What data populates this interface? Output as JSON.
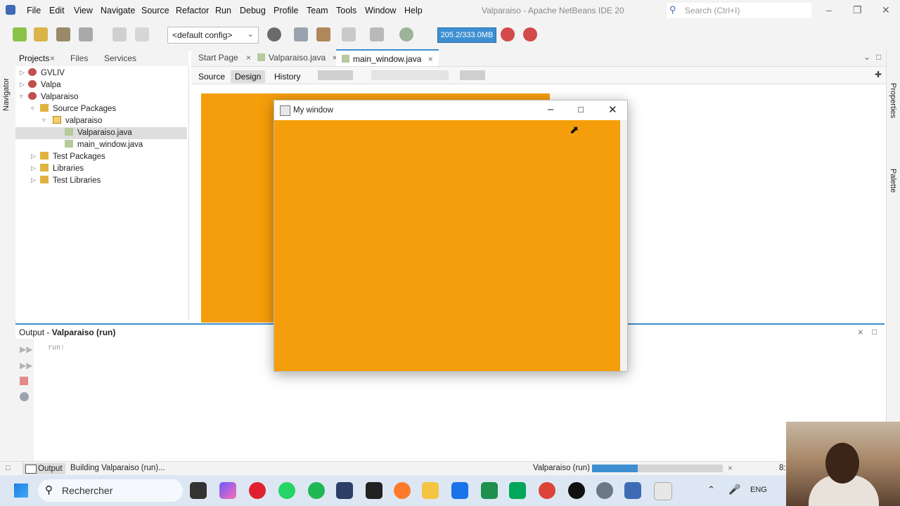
{
  "menubar": {
    "items": [
      "File",
      "Edit",
      "View",
      "Navigate",
      "Source",
      "Refactor",
      "Run",
      "Debug",
      "Profile",
      "Team",
      "Tools",
      "Window",
      "Help"
    ],
    "app_title": "Valparaiso - Apache NetBeans IDE 20",
    "search_placeholder": "Search (Ctrl+I)"
  },
  "toolbar": {
    "config_value": "<default config>",
    "memory": "205.2/333.0MB"
  },
  "left_panel": {
    "navigator_label": "Navigator",
    "tabs": [
      "Projects",
      "Files",
      "Services"
    ],
    "tree": [
      {
        "label": "GVLIV"
      },
      {
        "label": "Valpa"
      },
      {
        "label": "Valparaiso"
      },
      {
        "label": "Source Packages"
      },
      {
        "label": "valparaiso"
      },
      {
        "label": "Valparaiso.java"
      },
      {
        "label": "main_window.java"
      },
      {
        "label": "Test Packages"
      },
      {
        "label": "Libraries"
      },
      {
        "label": "Test Libraries"
      }
    ]
  },
  "editor": {
    "tabs": [
      "Start Page",
      "Valparaiso.java",
      "main_window.java"
    ],
    "views": [
      "Source",
      "Design",
      "History"
    ],
    "active_view": "Design"
  },
  "right_panel": {
    "labels": [
      "Properties",
      "Palette"
    ]
  },
  "output": {
    "title_prefix": "Output - ",
    "title_bold": "Valparaiso (run)",
    "text": "run:"
  },
  "statusbar": {
    "output_button": "Output",
    "building": "Building Valparaiso (run)...",
    "run_label": "Valparaiso (run)",
    "progress": 0.35,
    "position": "8:"
  },
  "my_window": {
    "title": "My window",
    "background_color": "#f59e0b"
  },
  "taskbar": {
    "search_placeholder": "Rechercher",
    "language": "ENG"
  },
  "colors": {
    "accent": "#3d8fd1",
    "form_orange": "#f59e0b"
  }
}
